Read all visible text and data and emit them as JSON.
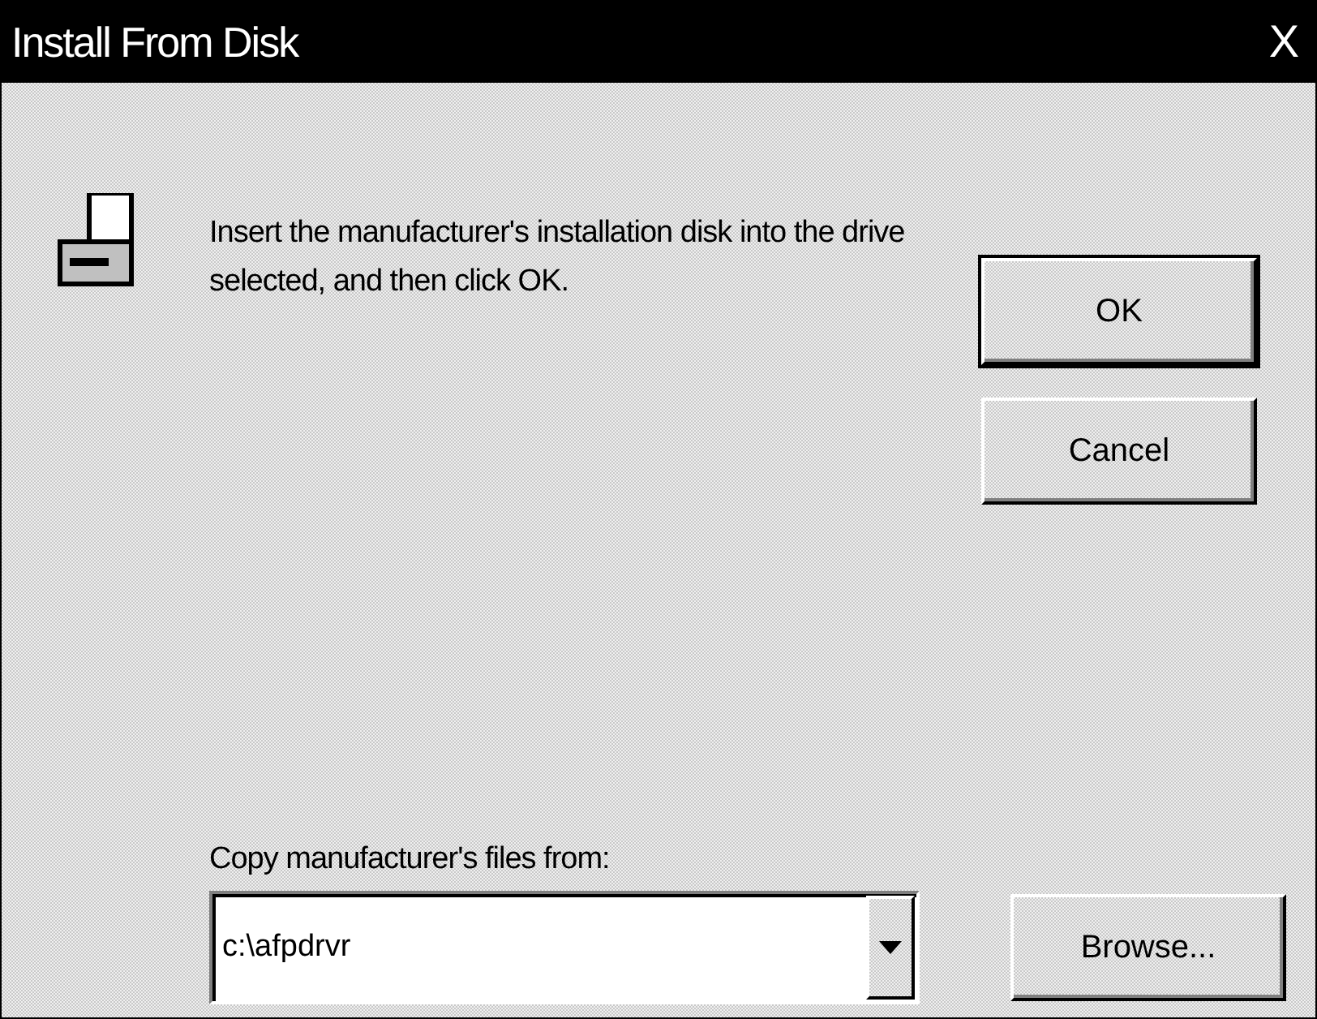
{
  "window": {
    "title": "Install From Disk",
    "close": "X"
  },
  "message": "Insert the manufacturer's installation disk into the drive selected, and then click OK.",
  "buttons": [
    {
      "label": "OK",
      "default": true
    },
    {
      "label": "Cancel",
      "default": false
    }
  ],
  "copy_from": {
    "label": "Copy manufacturer's files from:",
    "value": "c:\\afpdrvr"
  },
  "browse": {
    "label": "Browse..."
  }
}
